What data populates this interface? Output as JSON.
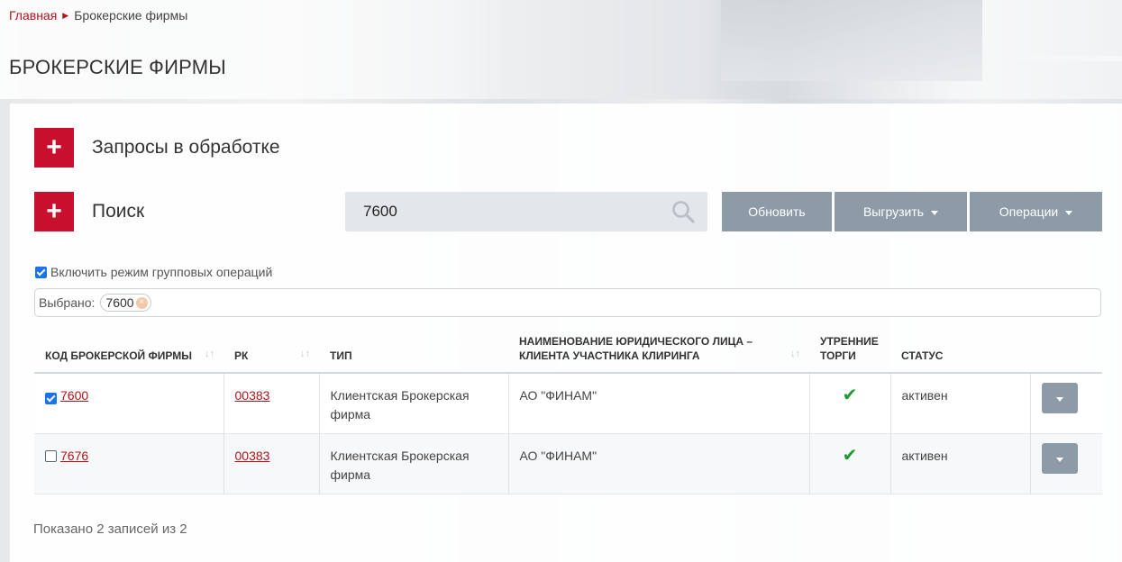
{
  "breadcrumb": {
    "home": "Главная",
    "current": "Брокерские фирмы"
  },
  "page_title": "БРОКЕРСКИЕ ФИРМЫ",
  "sections": {
    "requests": "Запросы в обработке",
    "search": "Поиск"
  },
  "search": {
    "value": "7600"
  },
  "toolbar": {
    "refresh": "Обновить",
    "export": "Выгрузить",
    "operations": "Операции"
  },
  "group_mode": {
    "label": "Включить режим групповых операций",
    "checked": true
  },
  "selected": {
    "label": "Выбрано:",
    "chips": [
      "7600"
    ]
  },
  "table": {
    "headers": {
      "code": "КОД БРОКЕРСКОЙ ФИРМЫ",
      "rk": "РК",
      "type": "ТИП",
      "name": "НАИМЕНОВАНИЕ ЮРИДИЧЕСКОГО ЛИЦА – КЛИЕНТА УЧАСТНИКА КЛИРИНГА",
      "morning": "УТРЕННИЕ ТОРГИ",
      "status": "СТАТУС"
    },
    "rows": [
      {
        "checked": true,
        "code": "7600",
        "rk": "00383",
        "type": "Клиентская Брокерская фирма",
        "name": "АО \"ФИНАМ\"",
        "morning": true,
        "status": "активен"
      },
      {
        "checked": false,
        "code": "7676",
        "rk": "00383",
        "type": "Клиентская Брокерская фирма",
        "name": "АО \"ФИНАМ\"",
        "morning": true,
        "status": "активен"
      }
    ]
  },
  "footer": "Показано 2 записей из 2",
  "colors": {
    "accent_red": "#c8102e",
    "link_red": "#b5121b",
    "button_gray": "#8d9aa7",
    "check_green": "#1e9a32"
  }
}
